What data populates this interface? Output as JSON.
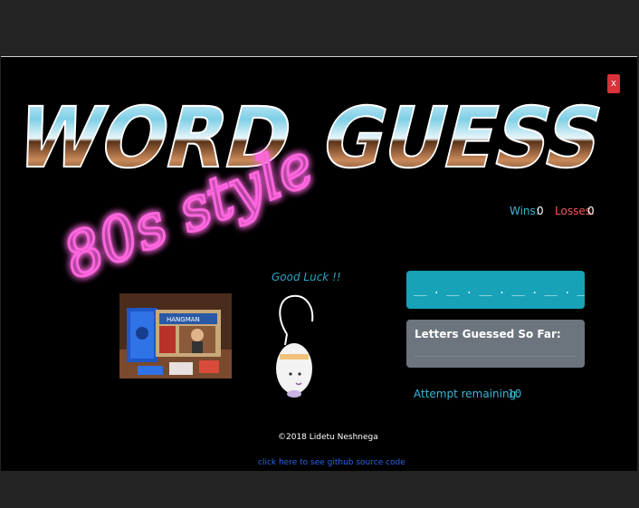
{
  "logo": {
    "title_word1": "WORD",
    "title_word2": "GUESS",
    "subtitle": "80s style"
  },
  "close_label": "x",
  "score": {
    "wins_label": "Wins:",
    "wins_value": "0",
    "losses_label": "Losses:",
    "losses_value": "0"
  },
  "greeting": "Good Luck !!",
  "game": {
    "word_display": "__ . __ . __ . __ . __ . __ .",
    "guessed_title": "Letters Guessed So Far:",
    "guessed_letters": "",
    "attempt_label": "Attempt remaining:",
    "attempt_value": "10"
  },
  "photo": {
    "box_brand": "HANGMAN"
  },
  "footer": {
    "copyright": "©2018 Lidetu Neshnega",
    "github_link": "click here to see github source code"
  },
  "colors": {
    "accent_cyan": "#17a2b8",
    "panel_gray": "#6c757d",
    "neon_pink": "#ff4fd8",
    "losses_red": "#f35a5a",
    "link_blue": "#2a64e8"
  }
}
